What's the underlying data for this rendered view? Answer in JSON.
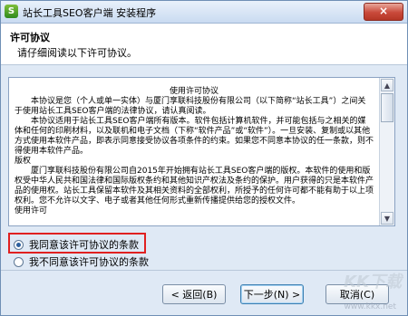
{
  "window": {
    "title": "站长工具SEO客户端 安装程序",
    "close_label": "×"
  },
  "header": {
    "title": "许可协议",
    "subtitle": "请仔细阅读以下许可协议。"
  },
  "license": {
    "heading": "使用许可协议",
    "paragraphs": [
      "本协议是您（个人或单一实体）与厦门享联科技股份有限公司（以下简称“站长工具”）之间关于使用站长工具SEO客户端的法律协议，请认真阅读。",
      "本协议适用于站长工具SEO客户端所有版本。软件包括计算机软件，并可能包括与之相关的媒体和任何的印刷材料，以及联机和电子文档（下称“软件产品”或“软件”）。一旦安装、复制或以其他方式使用本软件产品，即表示同意接受协议各项条件的约束。如果您不同意本协议的任一条款，则不得使用本软件产品。",
      "版权",
      "厦门享联科技股份有限公司自2015年开始拥有站长工具SEO客户端的版权。本软件的使用和版权受中华人民共和国法律和国际版权条约和其他知识产权法及条约的保护。用户获得的只是本软件产品的使用权。站长工具保留本软件及其相关资料的全部权利，所授予的任何许可都不能有助于以上项权利。您不允许以文字、电子或者其他任何形式重新传播提供给您的授权文件。",
      "使用许可"
    ]
  },
  "options": {
    "accept": "我同意该许可协议的条款",
    "decline": "我不同意该许可协议的条款"
  },
  "buttons": {
    "back": "< 返回(B)",
    "next": "下一步(N) >",
    "cancel": "取消(C)"
  },
  "watermark": {
    "text": "KK下载",
    "url": "www.kkx.net"
  }
}
